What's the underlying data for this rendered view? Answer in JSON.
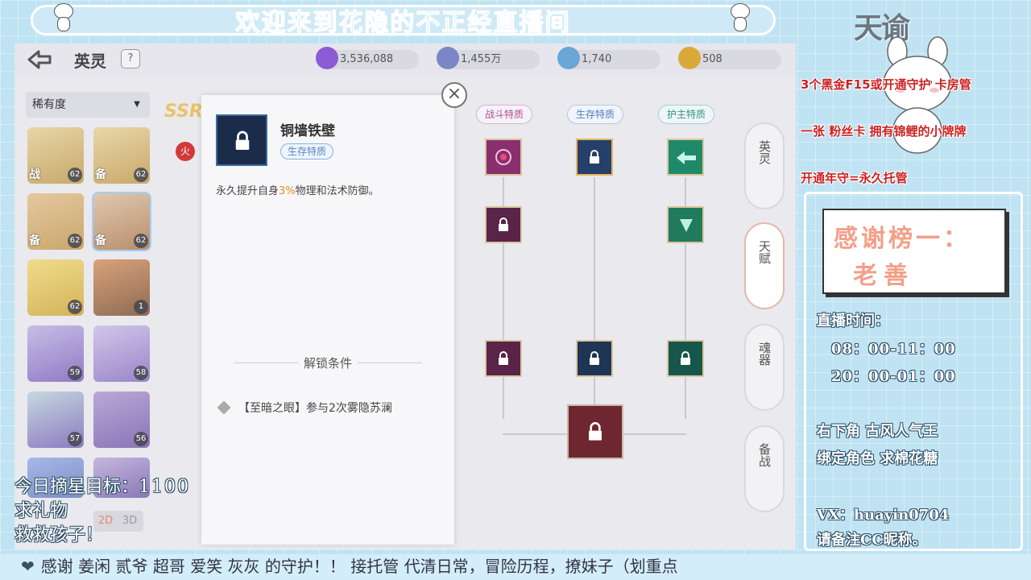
{
  "stream": {
    "banner": "欢迎来到花隐的不正经直播间",
    "goal_label": "今日摘星目标：",
    "goal_value": "1100",
    "gift_line1": "求礼物",
    "gift_line2": "救救孩子！",
    "ticker": "感谢 姜闲 贰爷 超哥 爱笑 灰灰 的守护！！      接托管 代清日常，冒险历程，撩妹子（划重点"
  },
  "right_panel": {
    "logo": "天谕",
    "notices": [
      "3个黑金F15或开通守护 卡房管",
      "一张 粉丝卡 拥有锦鲤的小牌牌",
      "开通年守=永久托管"
    ],
    "thanks_title": "感谢榜一：",
    "thanks_name": "老善",
    "live_time_label": "直播时间：",
    "live_times": [
      "08：00-11：00",
      "20：00-01：00"
    ],
    "ads": [
      "右下角 古风人气王",
      "绑定角色 求棉花糖"
    ],
    "contact": "VX：huayin0704",
    "contact_note": "请备注CC昵称。"
  },
  "game": {
    "title": "英灵",
    "help": "?",
    "resources": [
      {
        "icon": "crystal-icon",
        "value": "3,536,088",
        "color": "#8c5bd6"
      },
      {
        "icon": "star-coin-icon",
        "value": "1,455万",
        "color": "#7b86c8"
      },
      {
        "icon": "gem-icon",
        "value": "1,740",
        "color": "#6aa6d6"
      },
      {
        "icon": "gold-coin-icon",
        "value": "508",
        "color": "#d9a93a"
      }
    ],
    "filter_label": "稀有度",
    "view_2d": "2D",
    "view_3d": "3D",
    "ssr": "SSR",
    "element": "火",
    "heroes": [
      {
        "level": "62",
        "tag": "战",
        "color": "#c9a86a"
      },
      {
        "level": "62",
        "tag": "备",
        "color": "#c9a86a"
      },
      {
        "level": "62",
        "tag": "备",
        "color": "#c9a86a"
      },
      {
        "level": "62",
        "tag": "备",
        "color": "#b98f6c"
      },
      {
        "level": "62",
        "tag": "",
        "color": "#d4b35a"
      },
      {
        "level": "1",
        "tag": "",
        "color": "#8e6b55"
      },
      {
        "level": "59",
        "tag": "",
        "color": "#8f7bc4"
      },
      {
        "level": "58",
        "tag": "",
        "color": "#9b85c7"
      },
      {
        "level": "57",
        "tag": "",
        "color": "#8d7bc0"
      },
      {
        "level": "56",
        "tag": "",
        "color": "#8a74b8"
      },
      {
        "level": "",
        "tag": "",
        "color": "#7a8ec8"
      },
      {
        "level": "",
        "tag": "",
        "color": "#8b78b6"
      }
    ],
    "skill": {
      "name": "铜墙铁壁",
      "tag": "生存特质",
      "desc_pre": "永久提升自身",
      "desc_hl": "3%",
      "desc_post": "物理和法术防御。",
      "unlock_title": "解锁条件",
      "condition": "【至暗之眼】参与2次雾隐苏澜"
    },
    "tree_columns": [
      "战斗特质",
      "生存特质",
      "护主特质"
    ],
    "side_tabs": [
      "英灵",
      "天赋",
      "魂器",
      "备战"
    ],
    "close": "×"
  }
}
